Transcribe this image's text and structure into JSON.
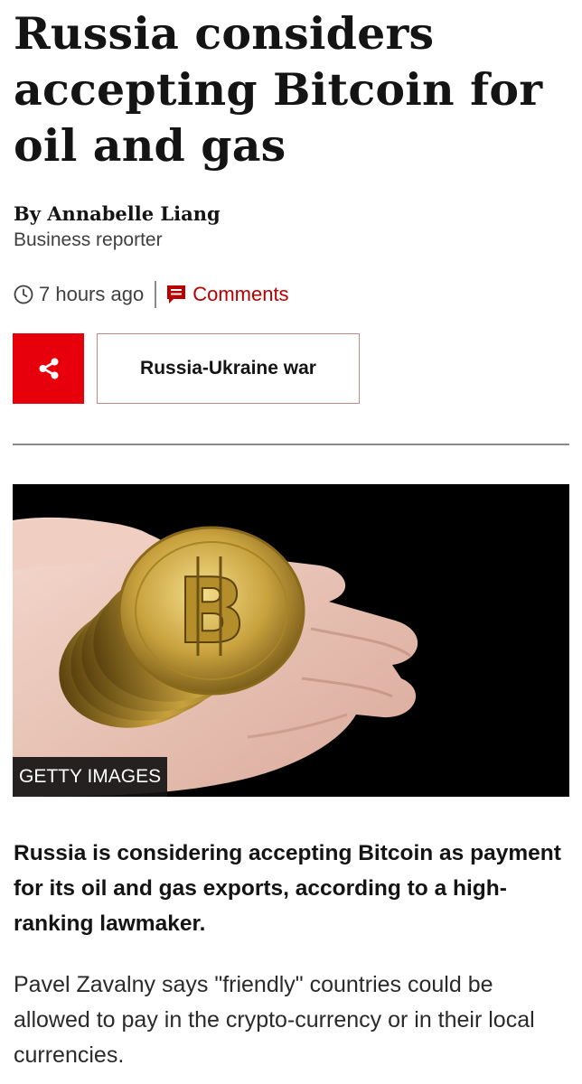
{
  "article": {
    "headline": "Russia considers accepting Bitcoin for oil and gas",
    "author": "By Annabelle Liang",
    "author_role": "Business reporter",
    "timestamp": "7 hours ago",
    "comments_label": "Comments",
    "share_icon": "share-icon",
    "topic_label": "Russia-Ukraine war",
    "image_credit": "GETTY IMAGES",
    "lead": "Russia is considering accepting Bitcoin as payment for its oil and gas exports, according to a high-ranking lawmaker.",
    "paragraph_1": "Pavel Zavalny says \"friendly\" countries could be allowed to pay in the crypto-currency or in their local currencies."
  },
  "colors": {
    "accent_red": "#e7000b",
    "comments_red": "#b80000",
    "text": "#141414"
  }
}
